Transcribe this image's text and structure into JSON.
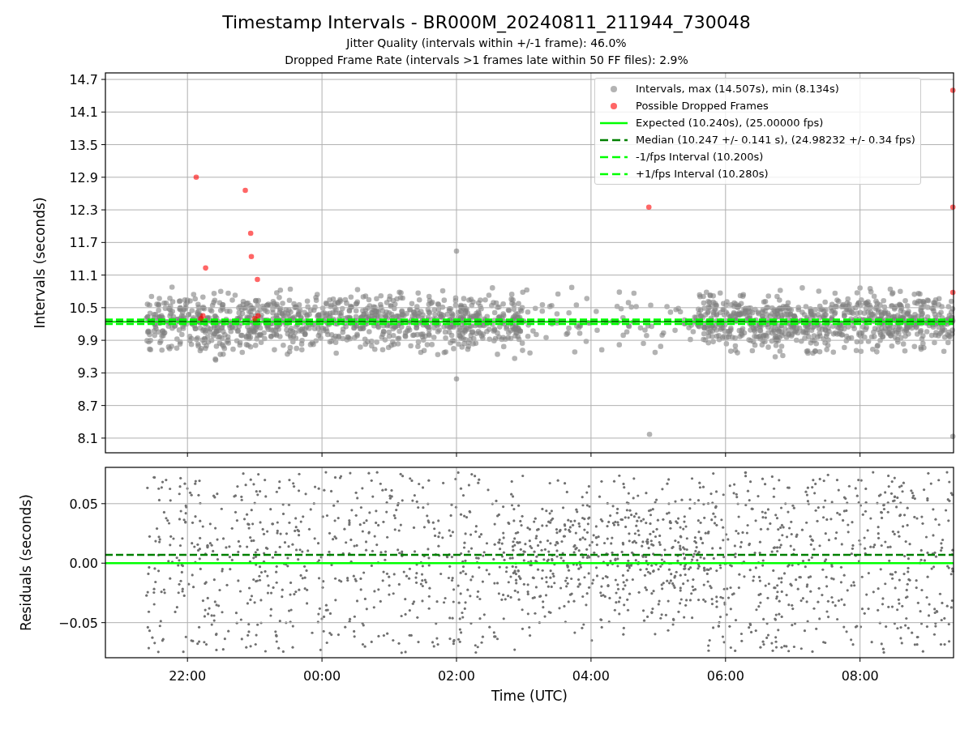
{
  "title": "Timestamp Intervals - BR000M_20240811_211944_730048",
  "subtitles": [
    "Jitter Quality (intervals within +/-1 frame): 46.0%",
    "Dropped Frame Rate (intervals >1 frames late within 50 FF files): 2.9%"
  ],
  "intervals_panel": {
    "chart_data": {
      "type": "scatter",
      "ylabel": "Intervals (seconds)",
      "grid": true,
      "xlim": [
        "2024-08-11T20:46:48Z",
        "2024-08-12T09:23:24Z"
      ],
      "ylim": [
        7.83,
        14.82
      ],
      "yticks": [
        8.1,
        8.7,
        9.3,
        9.9,
        10.5,
        11.1,
        11.7,
        12.3,
        12.9,
        13.5,
        14.1,
        14.7
      ],
      "series": [
        {
          "name": "Intervals, max (14.507s), min (8.134s)",
          "color": "#808080",
          "x": [
            "2024-08-12T02:00:00Z",
            "2024-08-12T02:00:00Z",
            "2024-08-12T04:52:12Z",
            "2024-08-12T09:22:48Z"
          ],
          "values": [
            11.54,
            9.19,
            8.17,
            8.13
          ]
        },
        {
          "name": "Possible Dropped Frames",
          "color": "#ff0000",
          "x": [
            "2024-08-11T22:07:48Z",
            "2024-08-11T22:16:12Z",
            "2024-08-11T22:12:00Z",
            "2024-08-11T22:13:48Z",
            "2024-08-11T22:51:36Z",
            "2024-08-11T22:56:24Z",
            "2024-08-11T22:57:00Z",
            "2024-08-11T23:02:24Z",
            "2024-08-11T23:00:00Z",
            "2024-08-11T23:03:00Z",
            "2024-08-12T04:51:36Z",
            "2024-08-12T09:22:48Z",
            "2024-08-12T09:22:48Z",
            "2024-08-12T09:22:48Z"
          ],
          "values": [
            12.9,
            11.23,
            10.3,
            10.35,
            12.66,
            11.87,
            11.44,
            11.02,
            10.3,
            10.35,
            12.35,
            14.5,
            12.35,
            10.78
          ]
        }
      ],
      "ref_lines": [
        {
          "label": "Expected (10.240s), (25.00000 fps)",
          "axis": "y",
          "value": 10.24,
          "color": "#00ff00"
        },
        {
          "label": "Median (10.247 +/- 0.141 s), (24.98232 +/- 0.34 fps)",
          "axis": "y",
          "value": 10.247,
          "color": "#008000"
        },
        {
          "label": "-1/fps Interval (10.200s)",
          "axis": "y",
          "value": 10.2,
          "color": "#00ff00"
        },
        {
          "label": "+1/fps Interval (10.280s)",
          "axis": "y",
          "value": 10.28,
          "color": "#00ff00"
        }
      ]
    }
  },
  "residuals_panel": {
    "chart_data": {
      "type": "scatter",
      "xlabel": "Time (UTC)",
      "ylabel": "Residuals (seconds)",
      "grid": true,
      "xlim": [
        "2024-08-11T20:46:48Z",
        "2024-08-12T09:23:24Z"
      ],
      "ylim": [
        -0.0795,
        0.0805
      ],
      "xticks": [
        {
          "value": "2024-08-11T22:00:00Z",
          "label": "22:00"
        },
        {
          "value": "2024-08-12T00:00:00Z",
          "label": "00:00"
        },
        {
          "value": "2024-08-12T02:00:00Z",
          "label": "02:00"
        },
        {
          "value": "2024-08-12T04:00:00Z",
          "label": "04:00"
        },
        {
          "value": "2024-08-12T06:00:00Z",
          "label": "06:00"
        },
        {
          "value": "2024-08-12T08:00:00Z",
          "label": "08:00"
        }
      ],
      "yticks": [
        {
          "value": -0.05,
          "label": "−0.05"
        },
        {
          "value": 0,
          "label": "0.00"
        },
        {
          "value": 0.05,
          "label": "0.05"
        }
      ],
      "ref_lines": [
        {
          "axis": "y",
          "value": 0,
          "color": "#00ff00"
        },
        {
          "axis": "y",
          "value": 0.007,
          "color": "#008000"
        }
      ]
    }
  }
}
